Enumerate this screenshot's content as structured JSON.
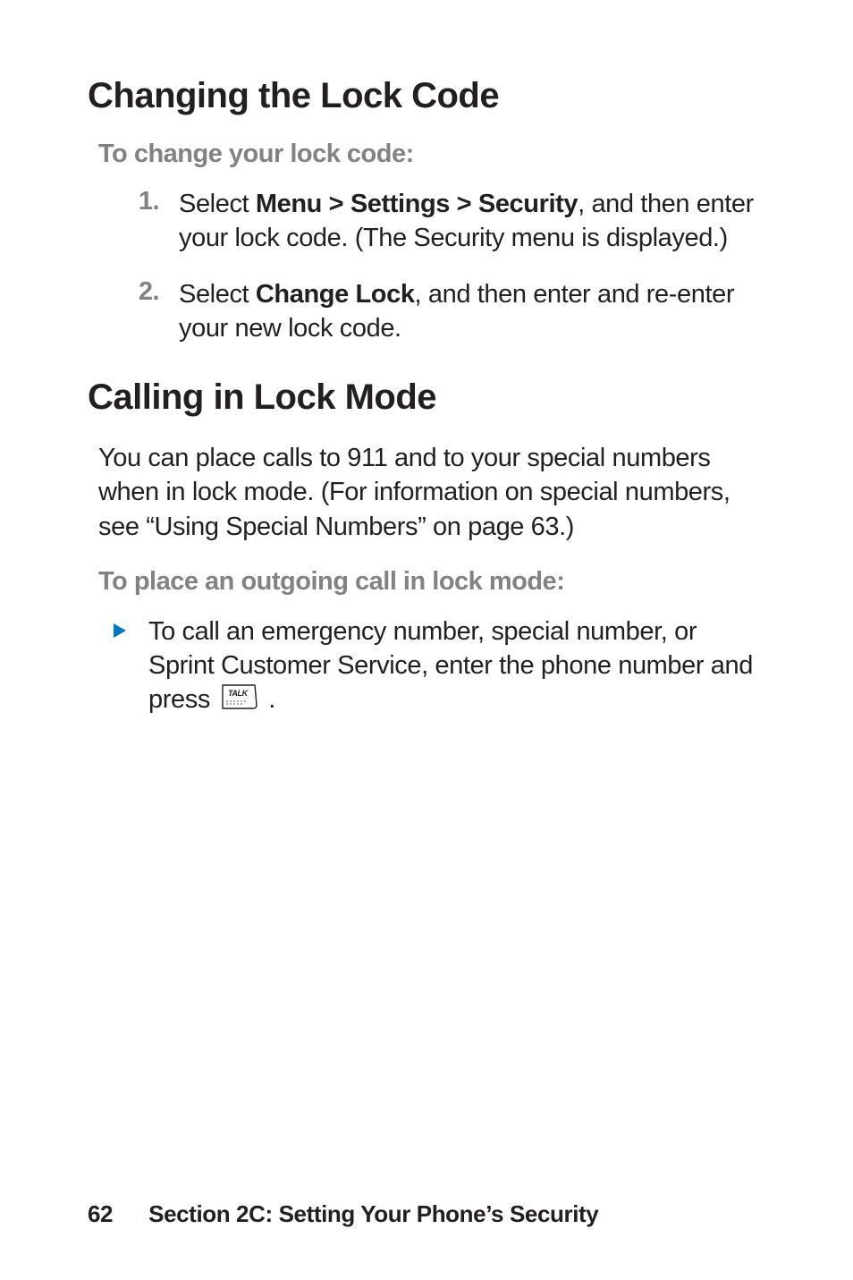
{
  "section1": {
    "heading": "Changing the Lock Code",
    "subhead": "To change your lock code:",
    "steps": [
      {
        "num": "1.",
        "pre": "Select ",
        "bold": "Menu > Settings > Security",
        "post": ", and then enter your lock code. (The Security menu is displayed.)"
      },
      {
        "num": "2.",
        "pre": "Select ",
        "bold": "Change Lock",
        "post": ", and then enter and re-enter your new lock code."
      }
    ]
  },
  "section2": {
    "heading": "Calling in Lock Mode",
    "intro": "You can place calls to 911 and to your special numbers when in lock mode. (For information on special numbers, see “Using Special Numbers” on page 63.)",
    "subhead": "To place an outgoing call in lock mode:",
    "bullet": {
      "line1": "To call an emergency number, special number, or Sprint Customer Service, enter the phone number and press ",
      "icon_label": "TALK",
      "line2": " ."
    }
  },
  "footer": {
    "page_number": "62",
    "section_label": "Section 2C: Setting Your Phone’s Security"
  }
}
